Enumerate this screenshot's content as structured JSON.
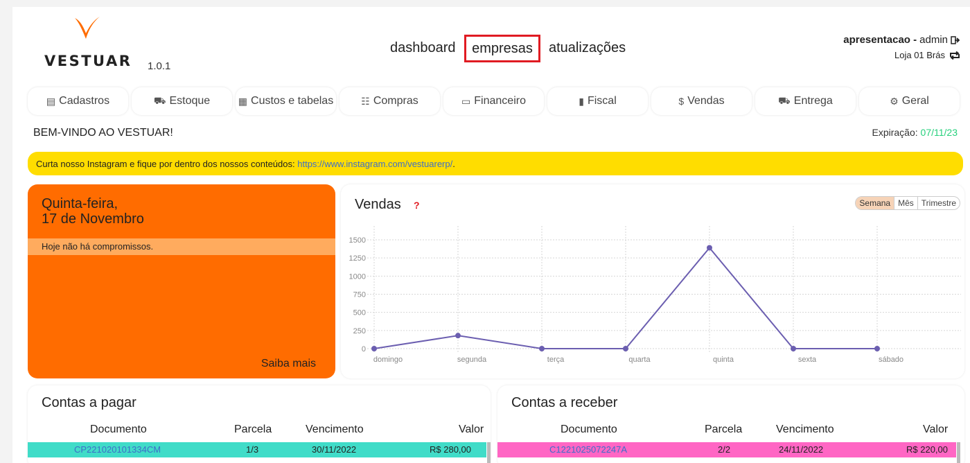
{
  "header": {
    "logo_text": "VESTUAR",
    "version": "1.0.1",
    "nav": [
      "dashboard",
      "empresas",
      "atualizações"
    ],
    "user_name": "apresentacao -",
    "user_role": "admin",
    "store": "Loja 01 Brás"
  },
  "tabs": [
    {
      "label": "Cadastros",
      "icon": "document-icon"
    },
    {
      "label": "Estoque",
      "icon": "truck-icon"
    },
    {
      "label": "Custos e tabelas",
      "icon": "table-icon"
    },
    {
      "label": "Compras",
      "icon": "cart-icon"
    },
    {
      "label": "Financeiro",
      "icon": "credit-card-icon"
    },
    {
      "label": "Fiscal",
      "icon": "file-icon"
    },
    {
      "label": "Vendas",
      "icon": "dollar-icon"
    },
    {
      "label": "Entrega",
      "icon": "truck-icon"
    },
    {
      "label": "Geral",
      "icon": "gears-icon"
    }
  ],
  "welcome": "BEM-VINDO AO VESTUAR!",
  "expiration": {
    "label": "Expiração:",
    "date": "07/11/23"
  },
  "notice": {
    "text": "Curta nosso Instagram e fique por dentro dos nossos conteúdos:",
    "link": "https://www.instagram.com/vestuarerp/",
    "tail": "."
  },
  "agenda": {
    "weekday": "Quinta-feira,",
    "date": "17 de Novembro",
    "empty_text": "Hoje não há compromissos.",
    "more": "Saiba mais"
  },
  "sales": {
    "title": "Vendas",
    "help": "?",
    "periods": [
      "Semana",
      "Mês",
      "Trimestre"
    ],
    "selected_period": "Semana"
  },
  "chart_data": {
    "type": "line",
    "title": "Vendas",
    "categories": [
      "domingo",
      "segunda",
      "terça",
      "quarta",
      "quinta",
      "sexta",
      "sábado"
    ],
    "values": [
      0,
      180,
      0,
      0,
      1390,
      0,
      0
    ],
    "y_ticks": [
      "0",
      "250",
      "500",
      "750",
      "1000",
      "1250",
      "1500"
    ],
    "ylim": [
      0,
      1500
    ],
    "grid": true,
    "colors": {
      "line": "#6b5eb0"
    }
  },
  "payables": {
    "title": "Contas a pagar",
    "columns": [
      "Documento",
      "Parcela",
      "Vencimento",
      "Valor"
    ],
    "rows": [
      [
        "CP221020101334CM",
        "1/3",
        "30/11/2022",
        "R$ 280,00"
      ]
    ],
    "row_color": "#40dcc8"
  },
  "receivables": {
    "title": "Contas a receber",
    "columns": [
      "Documento",
      "Parcela",
      "Vencimento",
      "Valor"
    ],
    "rows": [
      [
        "C1221025072247A",
        "2/2",
        "24/11/2022",
        "R$ 220,00"
      ]
    ],
    "row_color": "#ff66c4"
  }
}
